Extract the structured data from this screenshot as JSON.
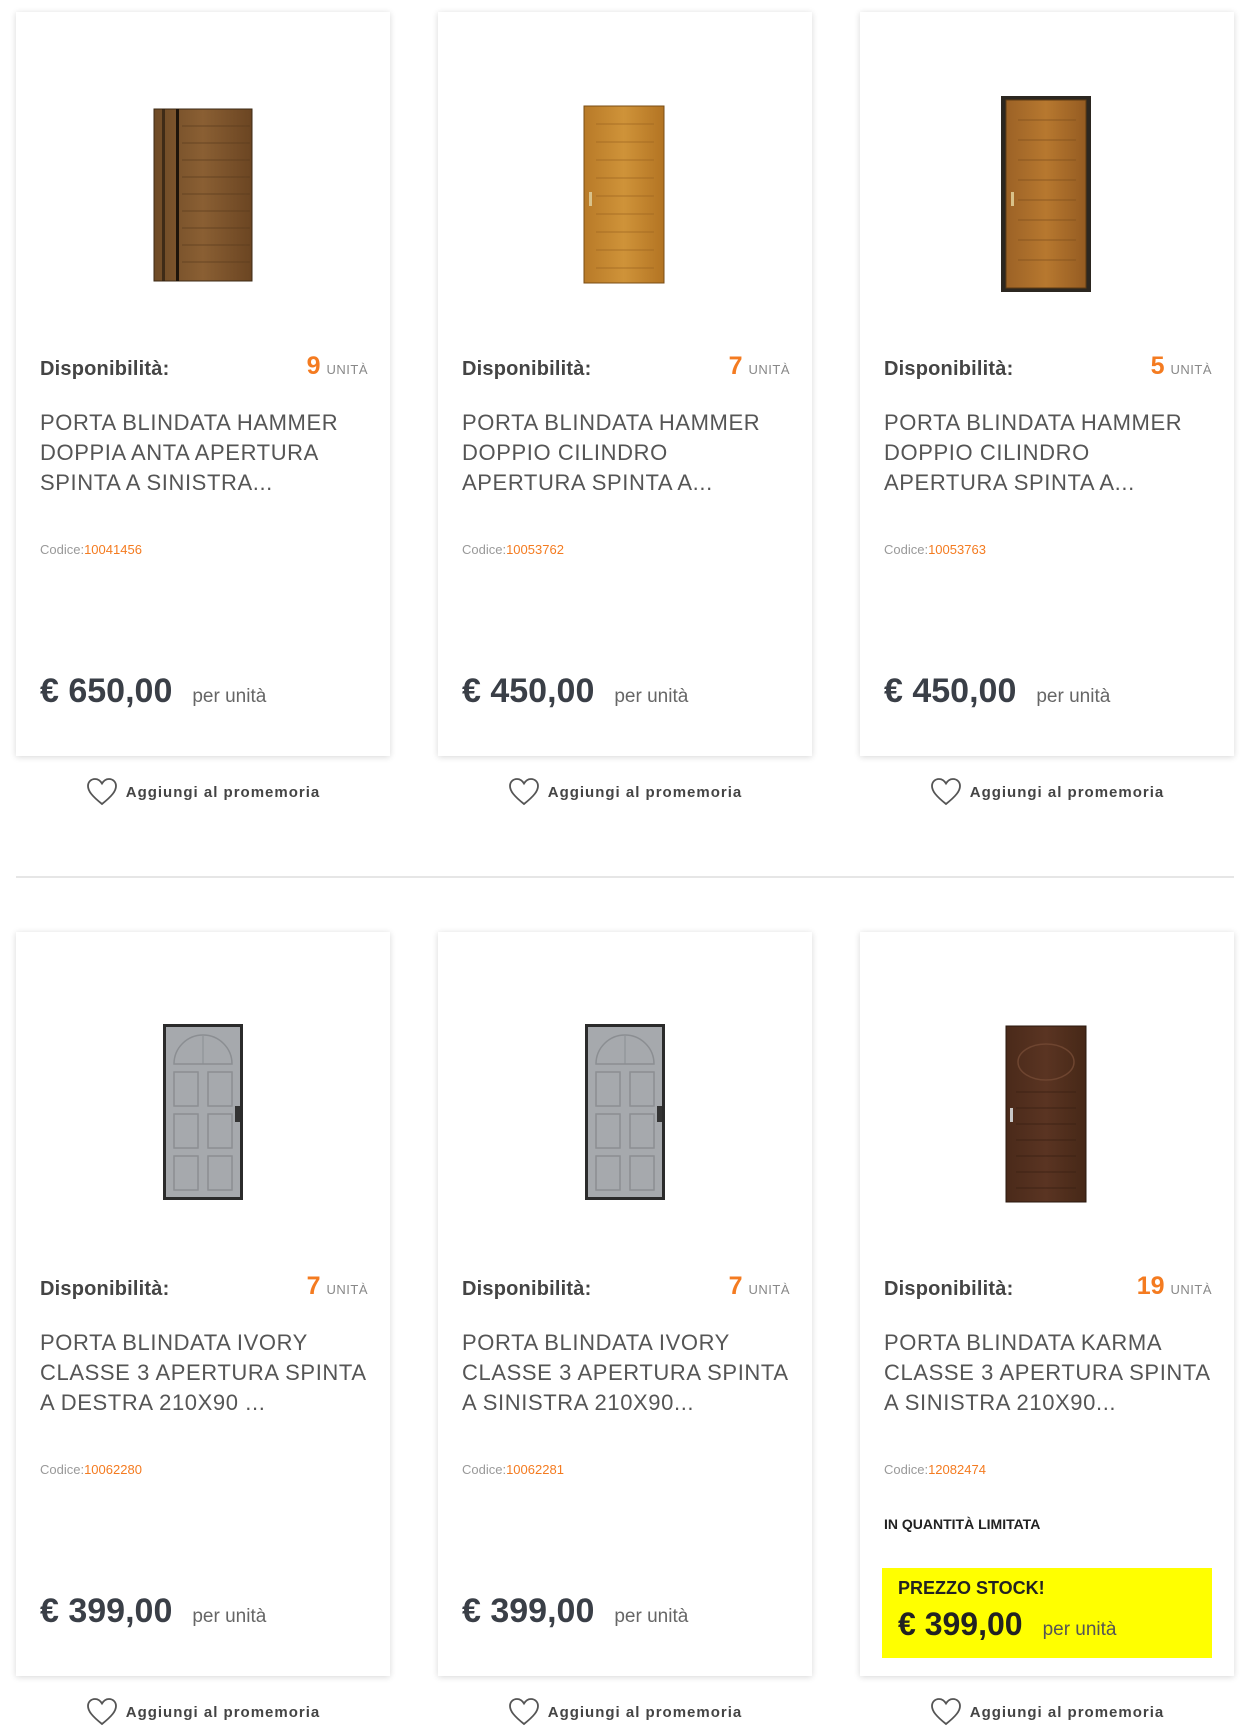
{
  "products": [
    {
      "availability_label": "Disponibilità:",
      "count": "9",
      "unit": "UNITÀ",
      "title": "PORTA BLINDATA HAMMER DOPPIA ANTA APERTURA SPINTA A SINISTRA...",
      "code_label": "Codice:",
      "code": "10041456",
      "price": "€ 650,00",
      "per_unit": "per unità",
      "wishlist": "Aggiungi al promemoria",
      "image": "door-wood-double-leaf-image"
    },
    {
      "availability_label": "Disponibilità:",
      "count": "7",
      "unit": "UNITÀ",
      "title": "PORTA BLINDATA HAMMER DOPPIO CILINDRO APERTURA SPINTA A...",
      "code_label": "Codice:",
      "code": "10053762",
      "price": "€ 450,00",
      "per_unit": "per unità",
      "wishlist": "Aggiungi al promemoria",
      "image": "door-light-wood-image"
    },
    {
      "availability_label": "Disponibilità:",
      "count": "5",
      "unit": "UNITÀ",
      "title": "PORTA BLINDATA HAMMER DOPPIO CILINDRO APERTURA SPINTA A...",
      "code_label": "Codice:",
      "code": "10053763",
      "price": "€ 450,00",
      "per_unit": "per unità",
      "wishlist": "Aggiungi al promemoria",
      "image": "door-wood-image"
    },
    {
      "availability_label": "Disponibilità:",
      "count": "7",
      "unit": "UNITÀ",
      "title": "PORTA BLINDATA IVORY CLASSE 3 APERTURA SPINTA A DESTRA 210X90 ...",
      "code_label": "Codice:",
      "code": "10062280",
      "price": "€ 399,00",
      "per_unit": "per unità",
      "wishlist": "Aggiungi al promemoria",
      "image": "door-grey-panel-image"
    },
    {
      "availability_label": "Disponibilità:",
      "count": "7",
      "unit": "UNITÀ",
      "title": "PORTA BLINDATA IVORY CLASSE 3 APERTURA SPINTA A SINISTRA 210X90...",
      "code_label": "Codice:",
      "code": "10062281",
      "price": "€ 399,00",
      "per_unit": "per unità",
      "wishlist": "Aggiungi al promemoria",
      "image": "door-grey-panel-image"
    },
    {
      "availability_label": "Disponibilità:",
      "count": "19",
      "unit": "UNITÀ",
      "title": "PORTA BLINDATA KARMA CLASSE 3 APERTURA SPINTA A SINISTRA 210X90...",
      "code_label": "Codice:",
      "code": "12082474",
      "limited": "IN QUANTITÀ LIMITATA",
      "stock_label": "PREZZO STOCK!",
      "price": "€ 399,00",
      "per_unit": "per unità",
      "wishlist": "Aggiungi al promemoria",
      "image": "door-dark-brown-image"
    }
  ],
  "colors": {
    "accent_orange": "#f47b20",
    "stock_highlight": "#ffff00",
    "price_text": "#3a3f47"
  }
}
